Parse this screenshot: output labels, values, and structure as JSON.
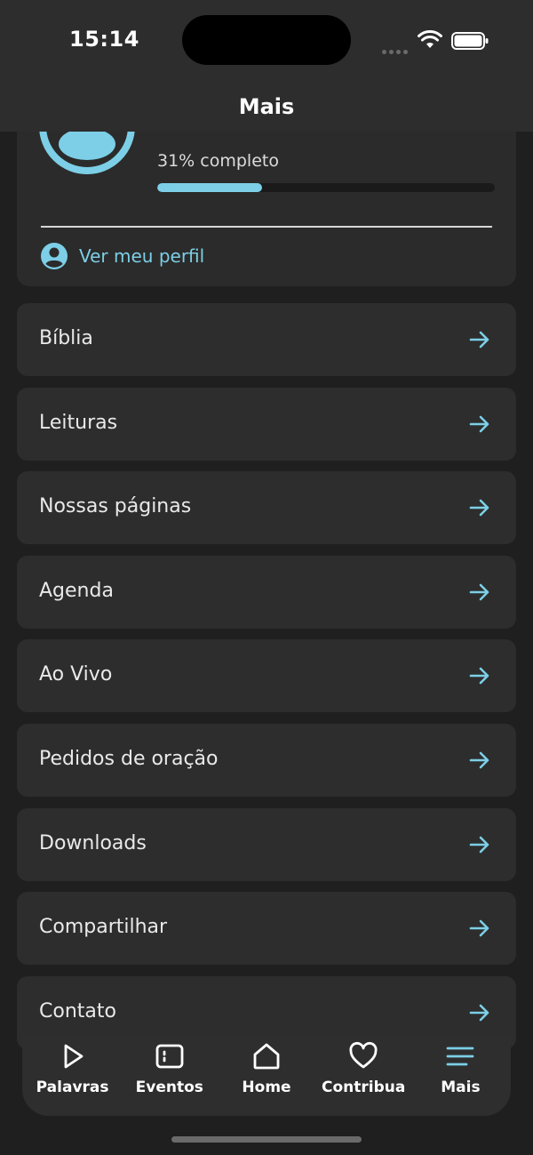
{
  "status": {
    "time": "15:14"
  },
  "header": {
    "title": "Mais"
  },
  "profile": {
    "progress_text": "31% completo",
    "progress_fraction": 0.31,
    "link_label": "Ver meu perfil"
  },
  "menu": {
    "items": [
      {
        "label": "Bíblia"
      },
      {
        "label": "Leituras"
      },
      {
        "label": "Nossas páginas"
      },
      {
        "label": "Agenda"
      },
      {
        "label": "Ao Vivo"
      },
      {
        "label": "Pedidos de oração"
      },
      {
        "label": "Downloads"
      },
      {
        "label": "Compartilhar"
      },
      {
        "label": "Contato"
      }
    ]
  },
  "tabbar": {
    "tabs": [
      {
        "label": "Palavras",
        "icon": "play-icon"
      },
      {
        "label": "Eventos",
        "icon": "calendar-icon"
      },
      {
        "label": "Home",
        "icon": "home-icon"
      },
      {
        "label": "Contribua",
        "icon": "heart-icon"
      },
      {
        "label": "Mais",
        "icon": "menu-icon",
        "active": true
      }
    ]
  },
  "colors": {
    "accent": "#7ccfe6",
    "background": "#1f1f1f",
    "card": "#2d2d2d"
  }
}
